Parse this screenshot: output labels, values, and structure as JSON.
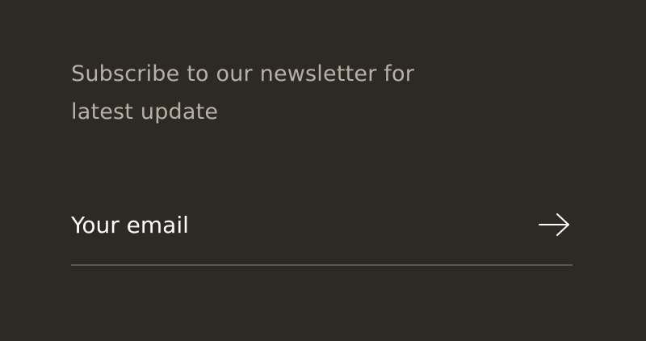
{
  "newsletter": {
    "heading": "Subscribe to our newsletter for latest update",
    "email_placeholder": "Your email",
    "email_value": "",
    "submit_icon": "arrow-right-icon"
  },
  "colors": {
    "background": "#2d2a26",
    "heading_text": "#b7b0a5",
    "input_text": "#ffffff",
    "underline": "#5a5650"
  }
}
